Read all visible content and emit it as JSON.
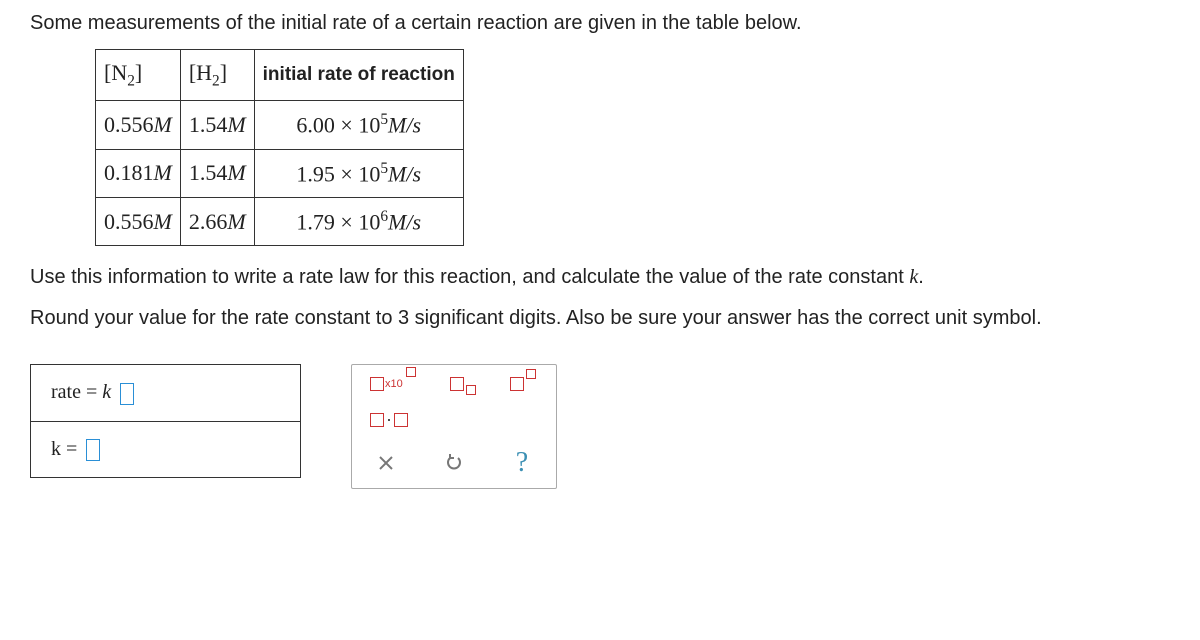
{
  "intro": "Some measurements of the initial rate of a certain reaction are given in the table below.",
  "table": {
    "headers": {
      "col1": "N",
      "col1_sub": "2",
      "col2": "H",
      "col2_sub": "2",
      "col3": "initial rate of reaction"
    },
    "rows": [
      {
        "n2": "0.556",
        "n2_unit": "M",
        "h2": "1.54",
        "h2_unit": "M",
        "rate_coef": "6.00 × 10",
        "rate_exp": "5",
        "rate_unit": "M/s"
      },
      {
        "n2": "0.181",
        "n2_unit": "M",
        "h2": "1.54",
        "h2_unit": "M",
        "rate_coef": "1.95 × 10",
        "rate_exp": "5",
        "rate_unit": "M/s"
      },
      {
        "n2": "0.556",
        "n2_unit": "M",
        "h2": "2.66",
        "h2_unit": "M",
        "rate_coef": "1.79 × 10",
        "rate_exp": "6",
        "rate_unit": "M/s"
      }
    ]
  },
  "instruction1_a": "Use this information to write a rate law for this reaction, and calculate the value of the rate constant ",
  "instruction1_k": "k",
  "instruction1_b": ".",
  "instruction2": "Round your value for the rate constant to 3 significant digits. Also be sure your answer has the correct unit symbol.",
  "answer": {
    "rate_label_a": "rate = ",
    "rate_label_k": "k",
    "k_label": "k = "
  },
  "toolbox": {
    "x10": "x10",
    "dot": "·"
  }
}
